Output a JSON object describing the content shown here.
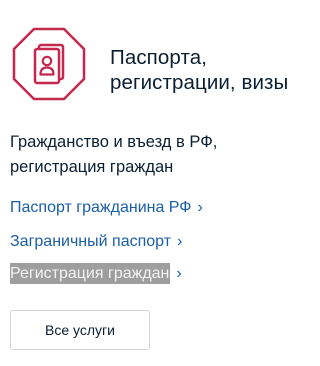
{
  "header": {
    "icon": "passport-icon",
    "accent_color": "#c5274f",
    "title_line1": "Паспорта,",
    "title_line2": "регистрации, визы"
  },
  "description": {
    "line1": "Гражданство и въезд в РФ,",
    "line2": "регистрация граждан"
  },
  "links": [
    {
      "label": "Паспорт гражданина РФ",
      "chevron": "›"
    },
    {
      "label": "Заграничный паспорт",
      "chevron": "›"
    },
    {
      "label": "Регистрация граждан",
      "chevron": "›"
    }
  ],
  "all_services_button": {
    "label": "Все услуги"
  }
}
